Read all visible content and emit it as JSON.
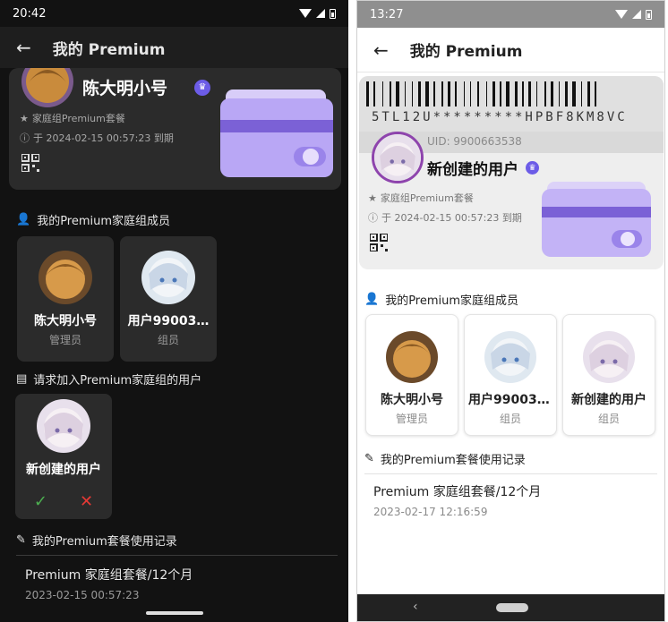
{
  "dark": {
    "status": {
      "time": "20:42"
    },
    "appbar": {
      "back": "←",
      "title": "我的 Premium"
    },
    "card": {
      "name": "陈大明小号",
      "plan": "家庭组Premium套餐",
      "expiry": "于 2024-02-15 00:57:23 到期"
    },
    "members_section": {
      "title": "我的Premium家庭组成员"
    },
    "members": [
      {
        "name": "陈大明小号",
        "role": "管理员"
      },
      {
        "name": "用户99003…",
        "role": "组员"
      }
    ],
    "requests_section": {
      "title": "请求加入Premium家庭组的用户"
    },
    "requests": [
      {
        "name": "新创建的用户",
        "accept": "✓",
        "reject": "✕"
      }
    ],
    "records_section": {
      "title": "我的Premium套餐使用记录"
    },
    "records": [
      {
        "title": "Premium 家庭组套餐/12个月",
        "date": "2023-02-15 00:57:23"
      }
    ]
  },
  "light": {
    "status": {
      "time": "13:27"
    },
    "appbar": {
      "back": "←",
      "title": "我的 Premium"
    },
    "card": {
      "code": "5TL12U*********HPBF8KM8VC",
      "uid": "UID: 9900663538",
      "name": "新创建的用户",
      "plan": "家庭组Premium套餐",
      "expiry": "于 2024-02-15 00:57:23 到期"
    },
    "members_section": {
      "title": "我的Premium家庭组成员"
    },
    "members": [
      {
        "name": "陈大明小号",
        "role": "管理员"
      },
      {
        "name": "用户990035…",
        "role": "组员"
      },
      {
        "name": "新创建的用户",
        "role": "组员"
      }
    ],
    "records_section": {
      "title": "我的Premium套餐使用记录"
    },
    "records": [
      {
        "title": "Premium 家庭组套餐/12个月",
        "date": "2023-02-17 12:16:59"
      }
    ],
    "nav": {
      "back": "‹"
    }
  },
  "colors": {
    "accent_purple": "#b9a7f5",
    "wallet_stripe": "#7b61d6",
    "accept_green": "#4caf50",
    "reject_red": "#e53935"
  }
}
